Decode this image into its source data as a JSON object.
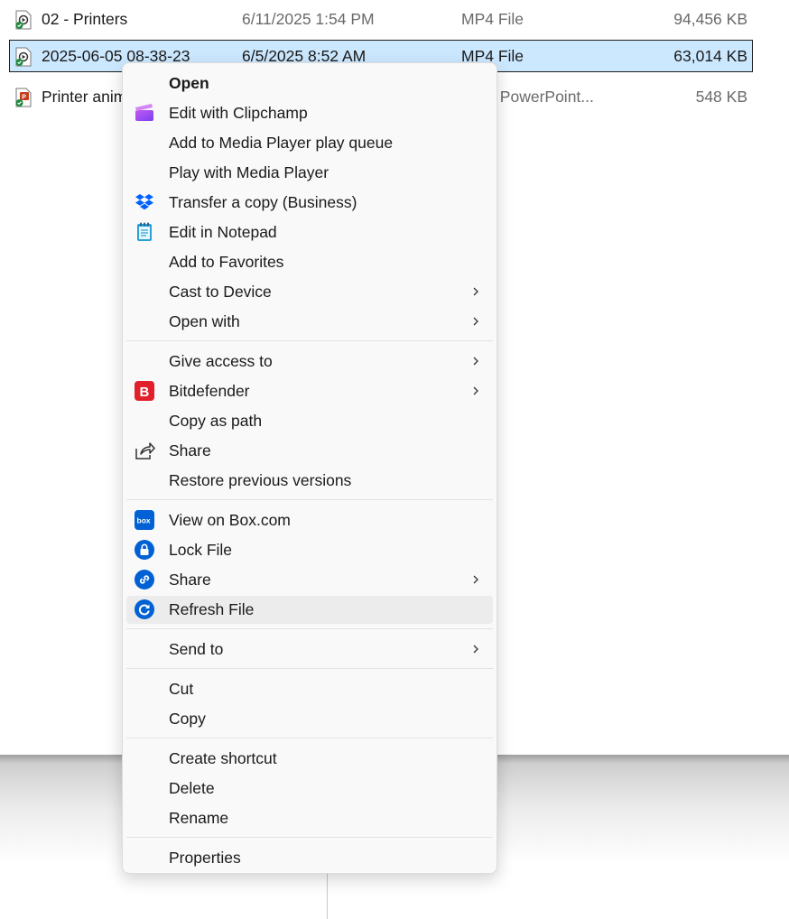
{
  "files": [
    {
      "name": "02 - Printers",
      "date": "6/11/2025 1:54 PM",
      "type": "MP4 File",
      "size": "94,456 KB",
      "icon": "video-file-icon",
      "selected": false
    },
    {
      "name": "2025-06-05 08-38-23",
      "date": "6/5/2025 8:52 AM",
      "type": "MP4 File",
      "size": "63,014 KB",
      "icon": "video-file-icon",
      "selected": true
    },
    {
      "name": "Printer anim",
      "date": "",
      "type": "osoft PowerPoint...",
      "size": "548 KB",
      "icon": "powerpoint-file-icon",
      "selected": false
    }
  ],
  "context_menu": {
    "groups": [
      [
        {
          "label": "Open",
          "bold": true
        },
        {
          "label": "Edit with Clipchamp",
          "icon": "clipchamp-icon"
        },
        {
          "label": "Add to Media Player play queue"
        },
        {
          "label": "Play with Media Player"
        },
        {
          "label": "Transfer a copy (Business)",
          "icon": "dropbox-icon"
        },
        {
          "label": "Edit in Notepad",
          "icon": "notepad-icon"
        },
        {
          "label": "Add to Favorites"
        },
        {
          "label": "Cast to Device",
          "submenu": true
        },
        {
          "label": "Open with",
          "submenu": true
        }
      ],
      [
        {
          "label": "Give access to",
          "submenu": true
        },
        {
          "label": "Bitdefender",
          "icon": "bitdefender-icon",
          "submenu": true
        },
        {
          "label": "Copy as path"
        },
        {
          "label": "Share",
          "icon": "share-icon"
        },
        {
          "label": "Restore previous versions"
        }
      ],
      [
        {
          "label": "View on Box.com",
          "icon": "box-icon"
        },
        {
          "label": "Lock File",
          "icon": "box-lock-icon"
        },
        {
          "label": "Share",
          "icon": "box-share-icon",
          "submenu": true
        },
        {
          "label": "Refresh File",
          "icon": "box-refresh-icon",
          "hovered": true
        }
      ],
      [
        {
          "label": "Send to",
          "submenu": true
        }
      ],
      [
        {
          "label": "Cut"
        },
        {
          "label": "Copy"
        }
      ],
      [
        {
          "label": "Create shortcut"
        },
        {
          "label": "Delete"
        },
        {
          "label": "Rename"
        }
      ],
      [
        {
          "label": "Properties"
        }
      ]
    ]
  },
  "colors": {
    "selection": "#cce8ff",
    "menu_background": "#f9f9f9",
    "hover": "#ececec",
    "box_blue": "#0061d5",
    "bitdefender_red": "#e2202b",
    "dropbox_blue": "#0061fe"
  }
}
